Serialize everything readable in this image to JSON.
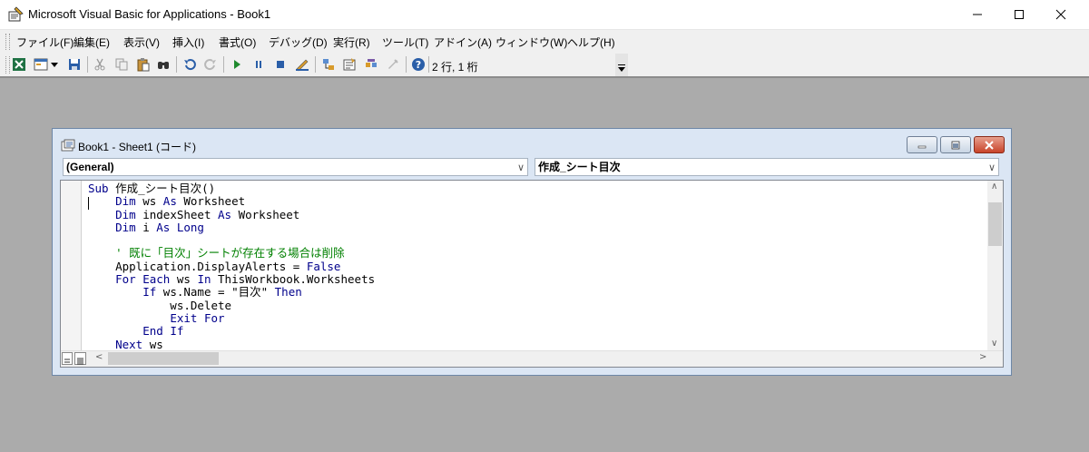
{
  "window": {
    "title": "Microsoft Visual Basic for Applications - Book1"
  },
  "menu": [
    "ファイル(F)",
    "編集(E)",
    "表示(V)",
    "挿入(I)",
    "書式(O)",
    "デバッグ(D)",
    "実行(R)",
    "ツール(T)",
    "アドイン(A)",
    "ウィンドウ(W)",
    "ヘルプ(H)"
  ],
  "toolbar": {
    "position": "2 行, 1 桁"
  },
  "code_window": {
    "title": "Book1 - Sheet1 (コード)",
    "object_combo": "(General)",
    "procedure_combo": "作成_シート目次"
  },
  "code_lines": [
    "Sub 作成_シート目次()",
    "    Dim ws As Worksheet",
    "    Dim indexSheet As Worksheet",
    "    Dim i As Long",
    "",
    "    ' 既に「目次」シートが存在する場合は削除",
    "    Application.DisplayAlerts = False",
    "    For Each ws In ThisWorkbook.Worksheets",
    "        If ws.Name = \"目次\" Then",
    "            ws.Delete",
    "            Exit For",
    "        End If",
    "    Next ws"
  ]
}
